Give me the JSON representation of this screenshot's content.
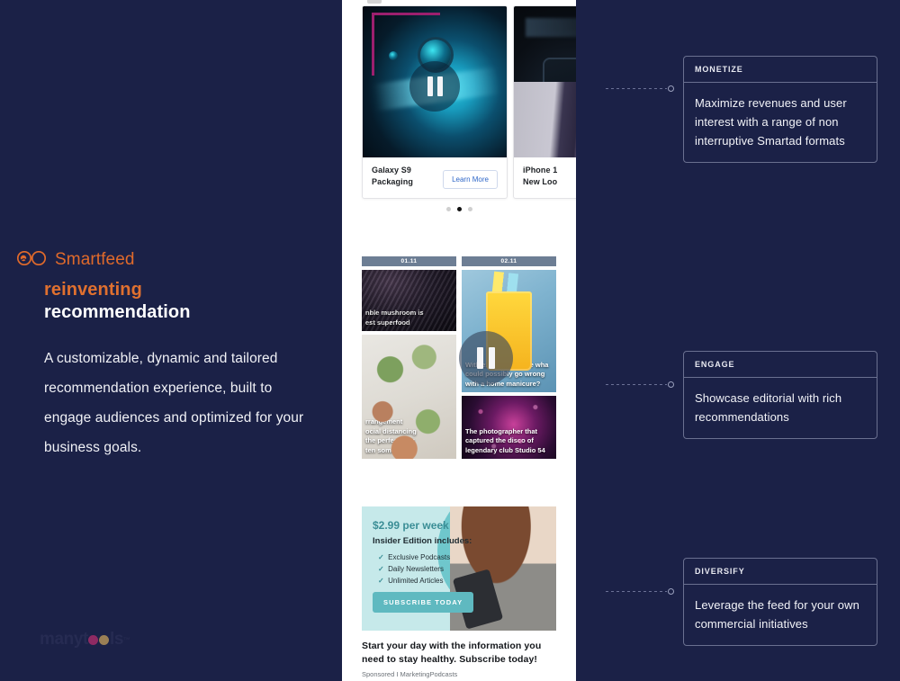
{
  "brand": {
    "logo_icon": "smartfeed-infinity-icon",
    "name": "Smartfeed",
    "accent_color": "#e06a2b"
  },
  "headline": {
    "line1": "reinventing",
    "line2": "recommendation"
  },
  "body_copy": "A customizable, dynamic and tailored recommendation experience, built to engage audiences and optimized for your business goals.",
  "watermark": {
    "prefix": "manyt",
    "suffix": "ls",
    "trademark": "™"
  },
  "phone": {
    "carousel": {
      "cards": [
        {
          "title": "Galaxy S9\nPackaging",
          "cta": "Learn More",
          "media": "galaxy-s9-teal-phone-video"
        },
        {
          "title": "iPhone 1\nNew Loo",
          "cta": "",
          "media": "iphone-hand-video"
        }
      ],
      "pagination": {
        "count": 3,
        "active_index": 1
      }
    },
    "grid": {
      "columns": [
        {
          "date": "01.11",
          "tiles": [
            {
              "caption": "nble mushroom is\nest superfood",
              "media": "mushroom-photo"
            },
            {
              "caption": "rrangement\nocial distancing\nthe perfect way\nten someone's",
              "media": "plants-photo"
            }
          ]
        },
        {
          "date": "02.11",
          "tiles": [
            {
              "caption": "With expert guidance wha\ncould possibly go wrong\nwith a home manicure?",
              "media": "manicure-juice-photo"
            },
            {
              "caption": "The photographer that\ncaptured the disco of\nlegendary club Studio 54",
              "media": "disco-ball-photo"
            }
          ]
        }
      ],
      "play_overlay_icon": "pause-icon"
    },
    "ad": {
      "price": "$2.99 per week",
      "subtitle": "Insider Edition includes:",
      "benefits": [
        "Exclusive Podcasts",
        "Daily Newsletters",
        "Unlimited Articles"
      ],
      "cta": "SUBSCRIBE TODAY",
      "headline": "Start your day with the information you need to stay healthy. Subscribe today!",
      "meta": "Sponsored I MarketingPodcasts"
    }
  },
  "callouts": [
    {
      "header": "MONETIZE",
      "body": "Maximize revenues and user interest with a range of non interruptive Smartad formats"
    },
    {
      "header": "ENGAGE",
      "body": "Showcase editorial with rich recommendations"
    },
    {
      "header": "DIVERSIFY",
      "body": "Leverage the feed for your own commercial initiatives"
    }
  ]
}
